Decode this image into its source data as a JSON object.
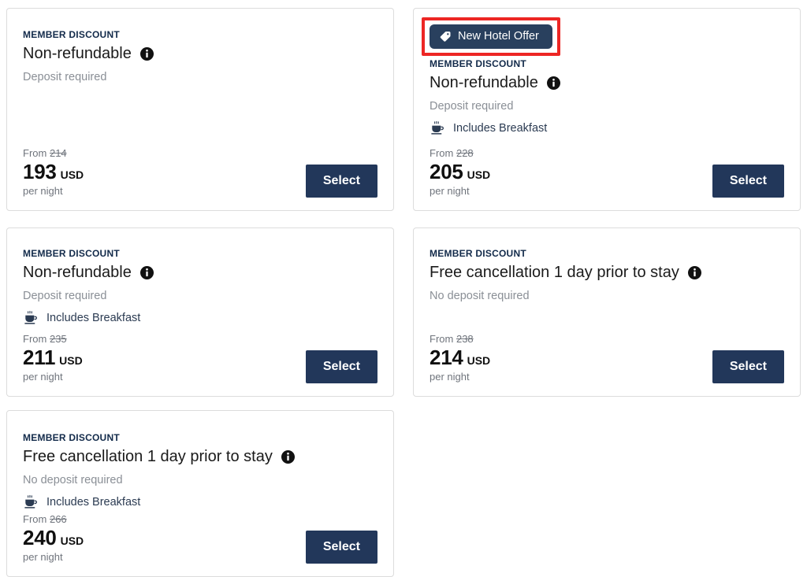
{
  "colors": {
    "accent_navy": "#22375a",
    "badge_navy": "#29405e",
    "highlight_red": "#ed2624",
    "card_border": "#dcdcdc",
    "muted_text": "#8a8f96",
    "heading_navy": "#122a4a"
  },
  "common": {
    "member_discount_label": "MEMBER DISCOUNT",
    "select_label": "Select",
    "from_label": "From",
    "currency": "USD",
    "per_night_label": "per night",
    "info_icon_name": "info-icon",
    "breakfast_icon_name": "coffee-cup-icon",
    "tag_icon_name": "tag-icon"
  },
  "cards": [
    {
      "id": "rate-option-1",
      "badge": null,
      "member_label": "MEMBER DISCOUNT",
      "title": "Non-refundable",
      "deposit": "Deposit required",
      "amenity": null,
      "from_label": "From",
      "old_price": "214",
      "amount": "193",
      "currency": "USD",
      "per_night": "per night",
      "select_label": "Select"
    },
    {
      "id": "rate-option-2",
      "badge": "New Hotel Offer",
      "member_label": "MEMBER DISCOUNT",
      "title": "Non-refundable",
      "deposit": "Deposit required",
      "amenity": "Includes Breakfast",
      "from_label": "From",
      "old_price": "228",
      "amount": "205",
      "currency": "USD",
      "per_night": "per night",
      "select_label": "Select"
    },
    {
      "id": "rate-option-3",
      "badge": null,
      "member_label": "MEMBER DISCOUNT",
      "title": "Non-refundable",
      "deposit": "Deposit required",
      "amenity": "Includes Breakfast",
      "from_label": "From",
      "old_price": "235",
      "amount": "211",
      "currency": "USD",
      "per_night": "per night",
      "select_label": "Select"
    },
    {
      "id": "rate-option-4",
      "badge": null,
      "member_label": "MEMBER DISCOUNT",
      "title": "Free cancellation 1 day prior to stay",
      "deposit": "No deposit required",
      "amenity": null,
      "from_label": "From",
      "old_price": "238",
      "amount": "214",
      "currency": "USD",
      "per_night": "per night",
      "select_label": "Select"
    },
    {
      "id": "rate-option-5",
      "badge": null,
      "member_label": "MEMBER DISCOUNT",
      "title": "Free cancellation 1 day prior to stay",
      "deposit": "No deposit required",
      "amenity": "Includes Breakfast",
      "from_label": "From",
      "old_price": "266",
      "amount": "240",
      "currency": "USD",
      "per_night": "per night",
      "select_label": "Select"
    }
  ]
}
